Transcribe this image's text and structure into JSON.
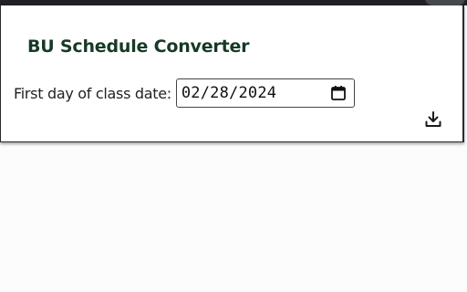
{
  "popup": {
    "title": "BU Schedule Converter",
    "date_label": "First day of class date:",
    "date_value": "02/28/2024"
  },
  "icons": {
    "calendar": "calendar-icon",
    "download": "download-icon"
  },
  "colors": {
    "title": "#163a27",
    "border": "#2b2b2b",
    "browser_bar": "#202124"
  }
}
